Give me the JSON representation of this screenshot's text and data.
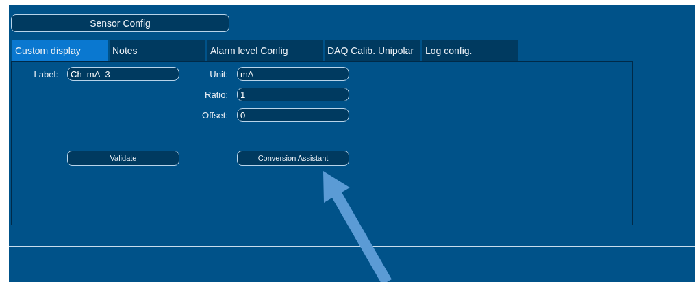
{
  "header_button": "Sensor Config",
  "tabs": [
    {
      "label": "Custom display",
      "selected": true
    },
    {
      "label": "Notes",
      "selected": false
    },
    {
      "label": "Alarm level Config",
      "selected": false
    },
    {
      "label": "DAQ Calib. Unipolar",
      "selected": false
    },
    {
      "label": "Log config.",
      "selected": false
    }
  ],
  "label_field": {
    "label": "Label:",
    "value": "Ch_mA_3"
  },
  "conversion_fields": [
    {
      "label": "Unit:",
      "value": "mA"
    },
    {
      "label": "Ratio:",
      "value": "1"
    },
    {
      "label": "Offset:",
      "value": "0"
    }
  ],
  "buttons": [
    "Validate",
    "Conversion Assistant"
  ]
}
